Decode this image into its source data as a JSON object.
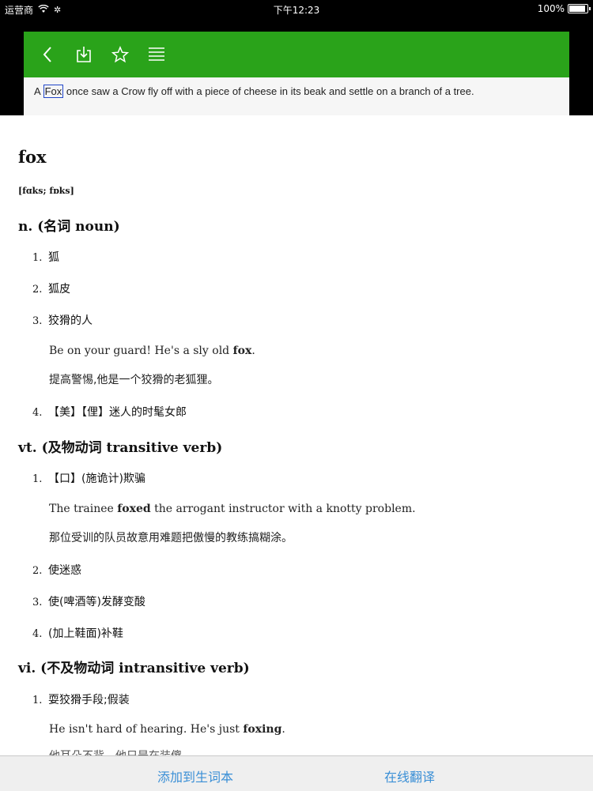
{
  "status": {
    "carrier": "运营商",
    "time": "下午12:23",
    "battery": "100%"
  },
  "toolbar": {
    "icons": [
      "back-icon",
      "download-icon",
      "star-icon",
      "list-icon"
    ],
    "accent": "#2aa31a"
  },
  "sentence": {
    "before": "A ",
    "highlight": "Fox",
    "after": " once saw a Crow fly off with a piece of cheese in its beak and settle on a branch of a tree."
  },
  "entry": {
    "word": "fox",
    "phonetic": "[fɑks; fɒks]",
    "noun": {
      "heading": "n. (名词 noun)",
      "senses": [
        {
          "num": "1.",
          "text": "狐"
        },
        {
          "num": "2.",
          "text": "狐皮"
        },
        {
          "num": "3.",
          "text": "狡猾的人"
        },
        {
          "num": "4.",
          "text": "【美】【俚】迷人的时髦女郎"
        }
      ],
      "example_en_pre": "Be on your guard! He's a sly old ",
      "example_en_bold": "fox",
      "example_en_post": ".",
      "example_zh": "提高警惕,他是一个狡猾的老狐狸。"
    },
    "vt": {
      "heading": "vt. (及物动词 transitive verb)",
      "senses": [
        {
          "num": "1.",
          "text": "【口】(施诡计)欺骗"
        },
        {
          "num": "2.",
          "text": "使迷惑"
        },
        {
          "num": "3.",
          "text": "使(啤酒等)发酵变酸"
        },
        {
          "num": "4.",
          "text": "(加上鞋面)补鞋"
        }
      ],
      "example_en_pre": "The trainee ",
      "example_en_bold": "foxed",
      "example_en_post": " the arrogant instructor with a knotty problem.",
      "example_zh": "那位受训的队员故意用难题把傲慢的教练搞糊涂。"
    },
    "vi": {
      "heading": "vi. (不及物动词 intransitive verb)",
      "senses": [
        {
          "num": "1.",
          "text": "耍狡猾手段;假装"
        }
      ],
      "example_en_pre": "He isn't hard of hearing. He's just ",
      "example_en_bold": "foxing",
      "example_en_post": ".",
      "example_zh_partial": "他耳朵不背，他只是在装傻"
    }
  },
  "bottom": {
    "add_label": "添加到生词本",
    "translate_label": "在线翻译",
    "link_color": "#3a8fd6"
  }
}
